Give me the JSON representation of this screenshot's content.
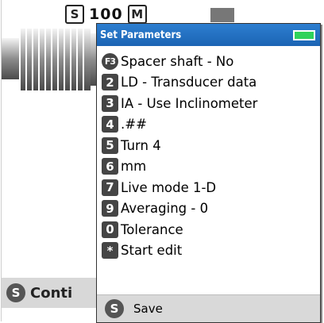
{
  "background": {
    "key_s": "S",
    "value": "100",
    "unit": "M",
    "bottom_key": "S",
    "bottom_label": "Conti"
  },
  "dialog": {
    "title": "Set Parameters",
    "battery_color": "#2fd25a",
    "items": [
      {
        "key": "F3",
        "label": "Spacer shaft - No",
        "key_shape": "circle"
      },
      {
        "key": "2",
        "label": "LD - Transducer data"
      },
      {
        "key": "3",
        "label": "IA - Use Inclinometer"
      },
      {
        "key": "4",
        "label": ".##"
      },
      {
        "key": "5",
        "label": "Turn  4"
      },
      {
        "key": "6",
        "label": "mm"
      },
      {
        "key": "7",
        "label": "Live mode 1-D"
      },
      {
        "key": "9",
        "label": "Averaging - 0"
      },
      {
        "key": "0",
        "label": "Tolerance"
      },
      {
        "key": "*",
        "label": "Start edit"
      }
    ],
    "footer": {
      "key": "S",
      "label": "Save"
    }
  }
}
